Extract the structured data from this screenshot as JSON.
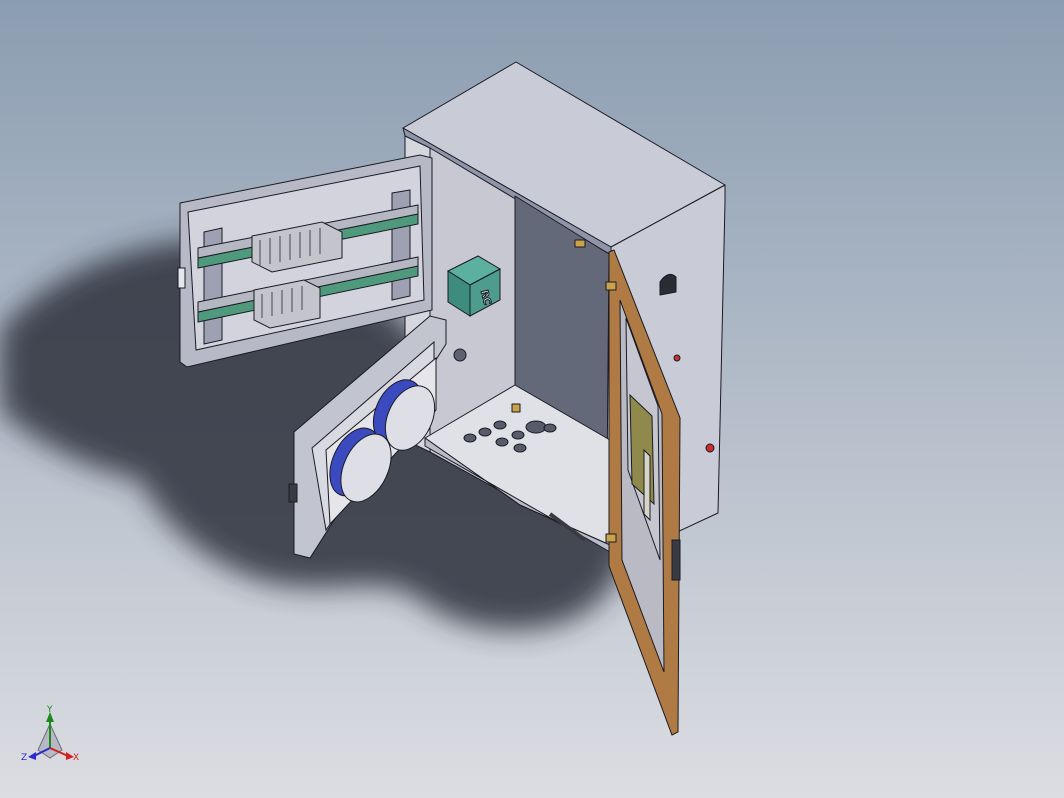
{
  "viewport": {
    "background_top": "#8b9db1",
    "background_bottom": "#dcdde2"
  },
  "model": {
    "enclosure_color": "#c9cbd6",
    "enclosure_shade": "#a9acbc",
    "interior_color": "#6e7280",
    "door_frame_color": "#b07a45",
    "din_rail_color": "#4f9a7c",
    "module_color": "#4d9c8d",
    "module_label": "RC",
    "disc_color": "#3b4bbf",
    "plate_color": "#e0e1e6"
  },
  "triad": {
    "x_label": "X",
    "y_label": "Y",
    "z_label": "Z",
    "x_color": "#d42020",
    "y_color": "#1a8a1a",
    "z_color": "#2a2ad0"
  }
}
